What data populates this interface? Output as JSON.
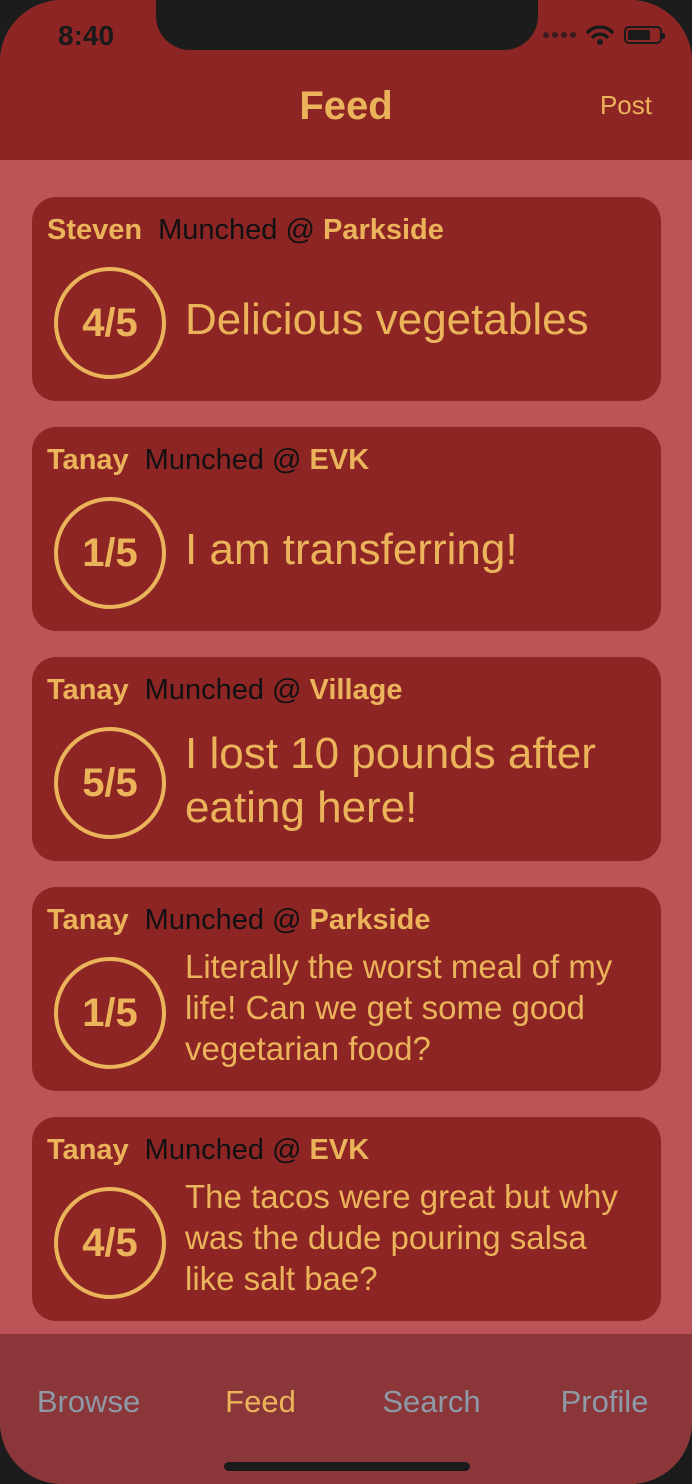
{
  "status_bar": {
    "time": "8:40"
  },
  "nav": {
    "title": "Feed",
    "post_label": "Post"
  },
  "feed": [
    {
      "user": "Steven",
      "action": "Munched @",
      "place": "Parkside",
      "rating": "4/5",
      "review": "Delicious vegetables"
    },
    {
      "user": "Tanay",
      "action": "Munched @",
      "place": "EVK",
      "rating": "1/5",
      "review": "I am transferring!"
    },
    {
      "user": "Tanay",
      "action": "Munched @",
      "place": "Village",
      "rating": "5/5",
      "review": "I lost 10 pounds after eating here!"
    },
    {
      "user": "Tanay",
      "action": "Munched @",
      "place": "Parkside",
      "rating": "1/5",
      "review": "Literally the worst meal of my life! Can we get some good vegetarian food?"
    },
    {
      "user": "Tanay",
      "action": "Munched @",
      "place": "EVK",
      "rating": "4/5",
      "review": "The tacos were great but why was the dude pouring salsa like salt bae?"
    }
  ],
  "tabs": [
    {
      "label": "Browse"
    },
    {
      "label": "Feed"
    },
    {
      "label": "Search"
    },
    {
      "label": "Profile"
    }
  ],
  "colors": {
    "accent": "#ecb45a",
    "header": "#8e2525",
    "background": "#bc5356",
    "tabbar": "#8b373a",
    "inactive_tab": "#8e9aa6"
  },
  "icons": [
    "wifi-icon",
    "battery-icon",
    "signal-dots-icon"
  ]
}
